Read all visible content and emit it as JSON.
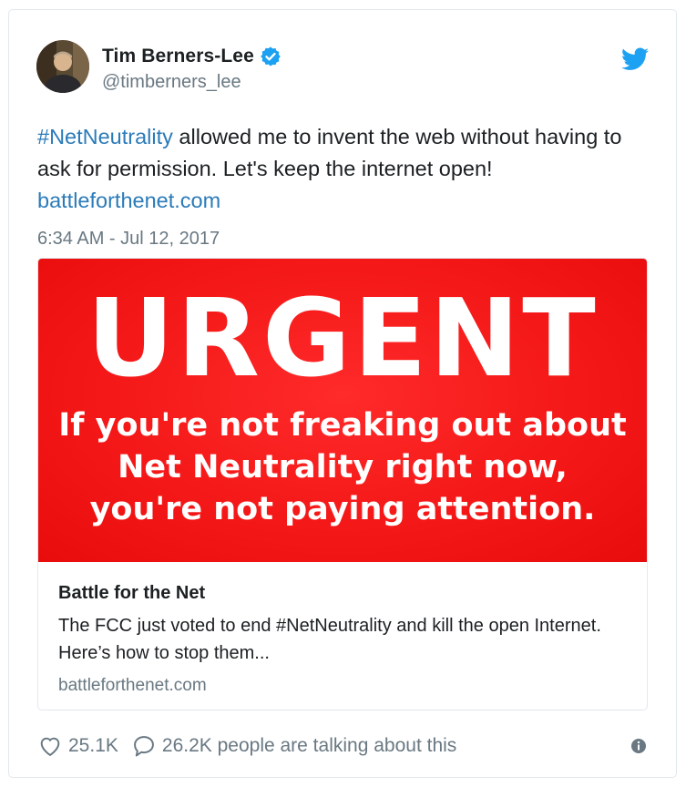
{
  "author": {
    "name": "Tim Berners-Lee",
    "handle": "@timberners_lee",
    "verified_icon": "verified-badge-icon",
    "brand_color": "#1da1f2"
  },
  "tweet": {
    "hashtag": "#NetNeutrality",
    "text_after_hashtag": " allowed me to invent the web without having to ask for permission. Let's keep the internet open! ",
    "link": "battleforthenet.com",
    "timestamp": "6:34 AM - Jul 12, 2017"
  },
  "card": {
    "image_headline": "URGENT",
    "image_lines": [
      "If you're not freaking out about",
      "Net Neutrality right now,",
      "you're not paying attention."
    ],
    "image_color": "#f41818",
    "title": "Battle for the Net",
    "description": "The FCC just voted to end #NetNeutrality and kill the open Internet. Here’s how to stop them...",
    "domain": "battleforthenet.com"
  },
  "footer": {
    "likes": "25.1K",
    "talking": "26.2K people are talking about this"
  },
  "colors": {
    "link": "#2b7bb9",
    "muted": "#697882",
    "text": "#1c2022",
    "border": "#e1e8ed"
  }
}
